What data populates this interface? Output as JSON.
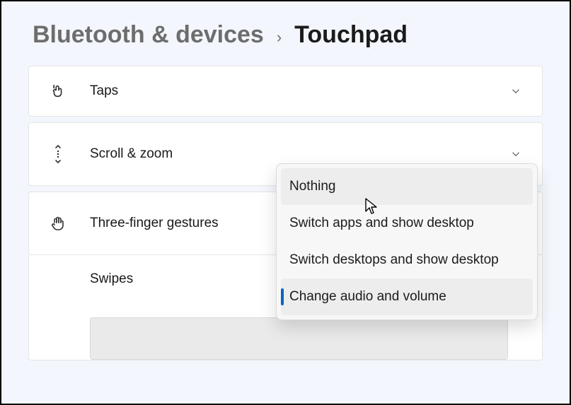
{
  "breadcrumb": {
    "parent": "Bluetooth & devices",
    "separator": "›",
    "current": "Touchpad"
  },
  "sections": {
    "taps": {
      "label": "Taps"
    },
    "scroll_zoom": {
      "label": "Scroll & zoom"
    },
    "three_finger": {
      "label": "Three-finger gestures"
    },
    "swipes": {
      "label": "Swipes"
    }
  },
  "dropdown": {
    "options": [
      {
        "label": "Nothing"
      },
      {
        "label": "Switch apps and show desktop"
      },
      {
        "label": "Switch desktops and show desktop"
      },
      {
        "label": "Change audio and volume"
      }
    ]
  }
}
